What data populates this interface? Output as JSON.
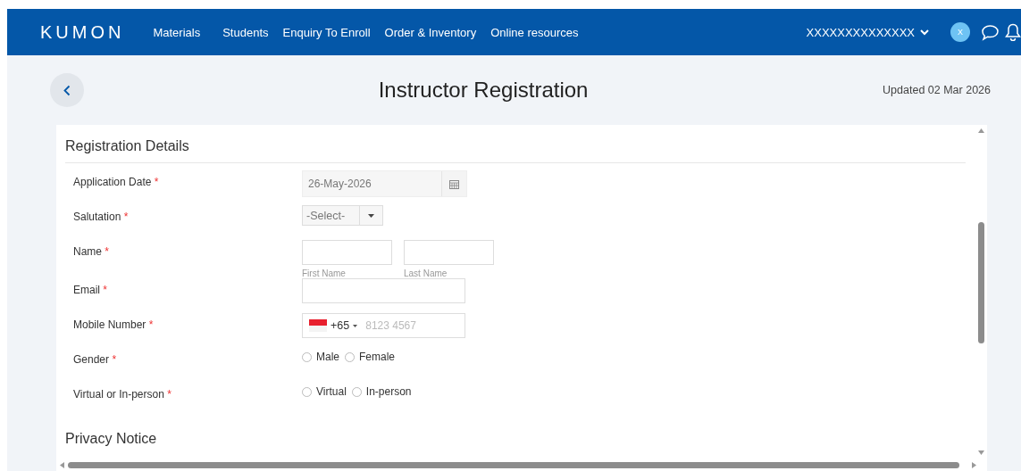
{
  "nav": {
    "logo": "KUMON",
    "links": [
      "Materials",
      "Students",
      "Enquiry To Enroll",
      "Order & Inventory",
      "Online resources"
    ],
    "user": "XXXXXXXXXXXXXX",
    "avatar": "X"
  },
  "header": {
    "title": "Instructor Registration",
    "updated": "Updated 02 Mar 2026"
  },
  "sections": [
    {
      "title": "Registration Details",
      "fields": [
        {
          "kind": "date",
          "label": "Application Date",
          "mark": "*",
          "value": "26-May-2026"
        },
        {
          "kind": "select",
          "label": "Salutation",
          "mark": "*",
          "value": "-Select-"
        },
        {
          "kind": "name",
          "label": "Name",
          "mark": "*",
          "hints": [
            "First Name",
            "Last Name"
          ]
        },
        {
          "kind": "text",
          "label": "Email",
          "mark": "*"
        },
        {
          "kind": "phone",
          "label": "Mobile Number",
          "mark": "*",
          "code": "+65",
          "placeholder": "8123 4567"
        },
        {
          "kind": "radio",
          "label": "Gender",
          "mark": "*",
          "options": [
            {
              "label": "Male",
              "selected": false
            },
            {
              "label": "Female",
              "selected": false
            }
          ]
        },
        {
          "kind": "radio",
          "label": "Virtual or In-person",
          "mark": "*",
          "options": [
            {
              "label": "Virtual",
              "selected": false
            },
            {
              "label": "In-person",
              "selected": false
            }
          ]
        }
      ]
    },
    {
      "title": "Privacy Notice"
    }
  ]
}
